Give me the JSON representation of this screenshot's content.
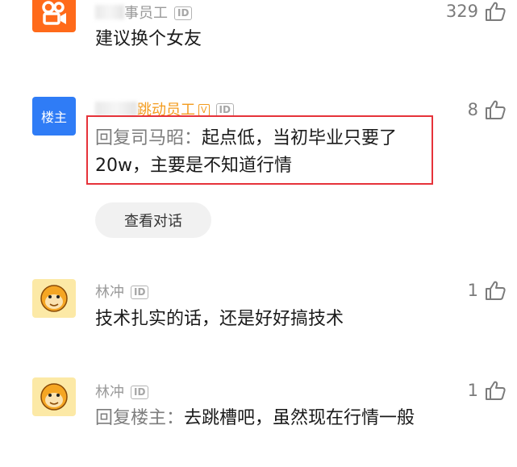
{
  "comments": [
    {
      "author_suffix": "事员工",
      "id_badge": "ID",
      "text": "建议换个女友",
      "likes": "329"
    },
    {
      "avatar_label": "楼主",
      "author_suffix": "跳动员工",
      "verified_badge": "V",
      "id_badge": "ID",
      "reply_prefix": "回复司马昭：",
      "text": "起点低，当初毕业只要了20w，主要是不知道行情",
      "likes": "8",
      "view_conversation": "查看对话"
    },
    {
      "author": "林冲",
      "id_badge": "ID",
      "text": "技术扎实的话，还是好好搞技术",
      "likes": "1"
    },
    {
      "author": "林冲",
      "id_badge": "ID",
      "reply_prefix": "回复楼主：",
      "text": "去跳槽吧，虽然现在行情一般",
      "likes": "1"
    }
  ],
  "colors": {
    "kuaishou_orange": "#ff6a1a",
    "owner_blue": "#2f7cf6",
    "highlight_red": "#e6333a",
    "verified_orange": "#f39b1d"
  }
}
